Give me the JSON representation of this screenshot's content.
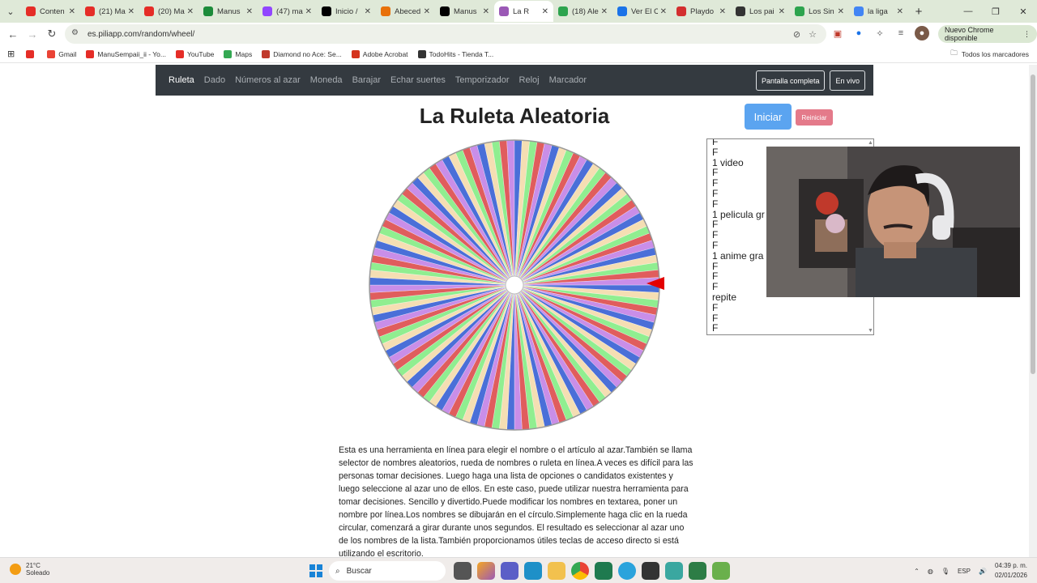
{
  "browser": {
    "tabs": [
      {
        "title": "Conten",
        "color": "#e52d27"
      },
      {
        "title": "(21) Ma",
        "color": "#e52d27"
      },
      {
        "title": "(20) Ma",
        "color": "#e52d27"
      },
      {
        "title": "Manus",
        "color": "#1c8b3a"
      },
      {
        "title": "(47) ma",
        "color": "#9146ff"
      },
      {
        "title": "Inicio /",
        "color": "#000000"
      },
      {
        "title": "Abeced",
        "color": "#e8710a"
      },
      {
        "title": "Manus",
        "color": "#000000"
      },
      {
        "title": "La R",
        "color": "#9b59b6",
        "active": true
      },
      {
        "title": "(18) Ale",
        "color": "#2da44e"
      },
      {
        "title": "Ver El C",
        "color": "#1a73e8"
      },
      {
        "title": "Playdo",
        "color": "#d32f2f"
      },
      {
        "title": "Los pai",
        "color": "#333333"
      },
      {
        "title": "Los Sin",
        "color": "#2da44e"
      },
      {
        "title": "la liga",
        "color": "#4285f4"
      }
    ],
    "url": "es.piliapp.com/random/wheel/",
    "update_label": "Nuevo Chrome disponible",
    "bookmarks": [
      {
        "label": "",
        "color": "#e52d27"
      },
      {
        "label": "Gmail",
        "color": "#ea4335"
      },
      {
        "label": "ManuSempaii_ii - Yo...",
        "color": "#e52d27"
      },
      {
        "label": "YouTube",
        "color": "#e52d27"
      },
      {
        "label": "Maps",
        "color": "#34a853"
      },
      {
        "label": "Diamond no Ace: Se...",
        "color": "#c0392b"
      },
      {
        "label": "Adobe Acrobat",
        "color": "#d4331d"
      },
      {
        "label": "TodoHits - Tienda T...",
        "color": "#333333"
      }
    ],
    "all_bookmarks": "Todos los marcadores"
  },
  "site": {
    "nav": [
      "Ruleta",
      "Dado",
      "Números al azar",
      "Moneda",
      "Barajar",
      "Echar suertes",
      "Temporizador",
      "Reloj",
      "Marcador"
    ],
    "fullscreen_label": "Pantalla completa",
    "live_label": "En vivo",
    "title": "La Ruleta Aleatoria",
    "start_label": "Iniciar",
    "reset_label": "Reiniciar",
    "names_lines": [
      "F",
      "F",
      "1 video",
      "F",
      "F",
      "F",
      "F",
      "1 pelicula gr",
      "F",
      "F",
      "F",
      "1 anime gra",
      "F",
      "F",
      "F",
      "repite",
      "F",
      "F",
      "F"
    ],
    "description": "Esta es una herramienta en línea para elegir el nombre o el artículo al azar.También se llama selector de nombres aleatorios, rueda de nombres o ruleta en línea.A veces es difícil para las personas tomar decisiones. Luego haga una lista de opciones o candidatos existentes y luego seleccione al azar uno de ellos. En este caso, puede utilizar nuestra herramienta para tomar decisiones. Sencillo y divertido.Puede modificar los nombres en textarea, poner un nombre por línea.Los nombres se dibujarán en el círculo.Simplemente haga clic en la rueda circular, comenzará a girar durante unos segundos. El resultado es seleccionar al azar uno de los nombres de la lista.También proporcionamos útiles teclas de acceso directo si está utilizando el escritorio.",
    "wheel_colors": [
      "#4a6fd8",
      "#f5deb3",
      "#90ee90",
      "#e05d5d",
      "#c98ee8"
    ],
    "wheel_segments": 120
  },
  "taskbar": {
    "temperature": "21°C",
    "weather": "Soleado",
    "search_placeholder": "Buscar",
    "language": "ESP",
    "time": "04:39 p. m.",
    "date": "02/01/2026"
  }
}
